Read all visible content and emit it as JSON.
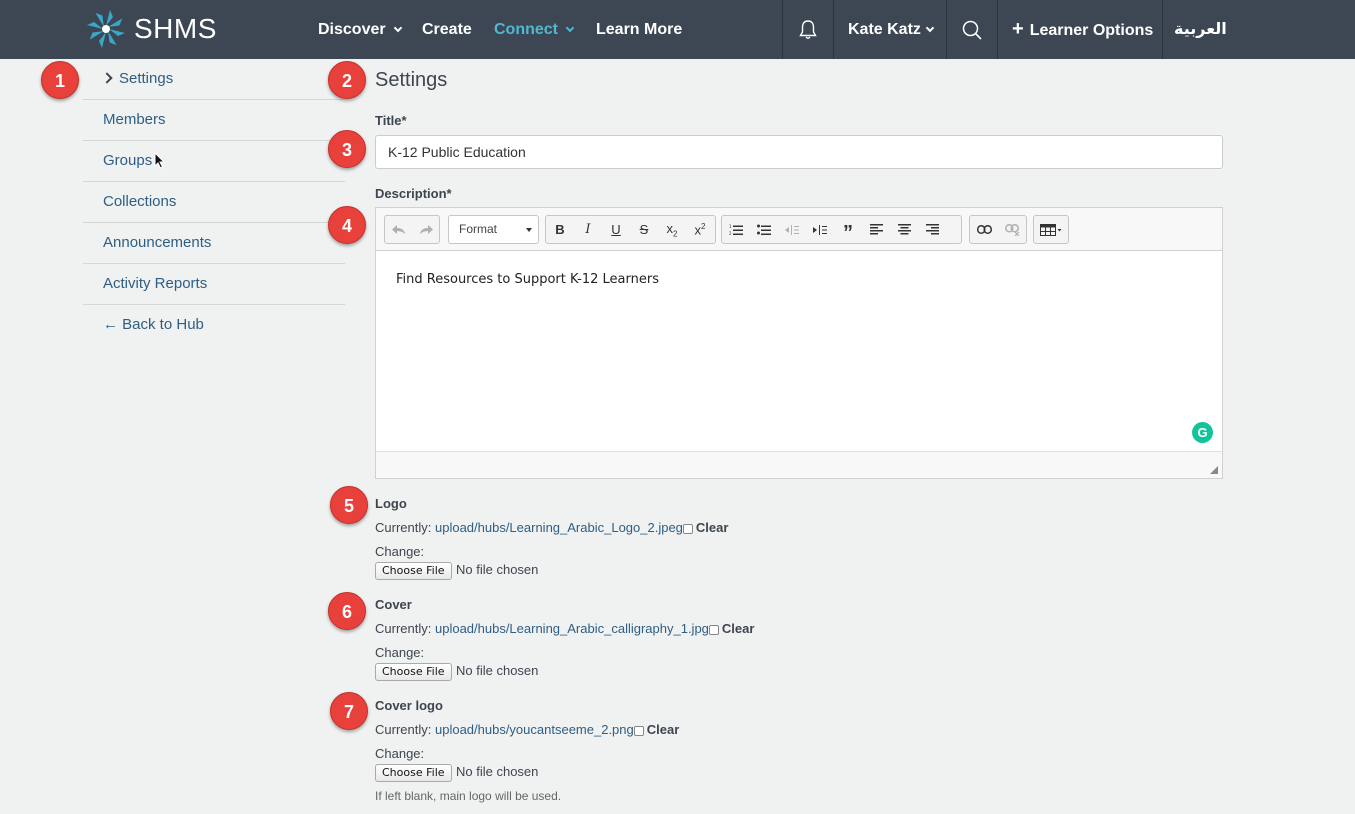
{
  "navbar": {
    "brand": "SHMS",
    "items": [
      {
        "label": "Discover"
      },
      {
        "label": "Create"
      },
      {
        "label": "Connect"
      },
      {
        "label": "Learn More"
      }
    ],
    "user_name": "Kate Katz",
    "learner_options": "Learner Options",
    "language": "العربية",
    "active_color": "#4fb9cf",
    "bg_color": "#3c4753"
  },
  "sidebar": {
    "items": [
      {
        "label": "Settings"
      },
      {
        "label": "Members"
      },
      {
        "label": "Groups"
      },
      {
        "label": "Collections"
      },
      {
        "label": "Announcements"
      },
      {
        "label": "Activity Reports"
      },
      {
        "label": "← Back to Hub"
      }
    ]
  },
  "badges": [
    "1",
    "2",
    "3",
    "4",
    "5",
    "6",
    "7"
  ],
  "main": {
    "title": "Settings",
    "title_field": {
      "label": "Title*",
      "value": "K-12 Public Education"
    },
    "description": {
      "label": "Description*",
      "format_label": "Format",
      "content": "Find Resources to Support K-12 Learners",
      "grammarly": "G"
    },
    "logo": {
      "label": "Logo",
      "currently": "Currently:",
      "path": "upload/hubs/Learning_Arabic_Logo_2.jpeg",
      "clear": "Clear",
      "change": "Change:",
      "choose": "Choose File",
      "nofile": "No file chosen"
    },
    "cover": {
      "label": "Cover",
      "currently": "Currently:",
      "path": "upload/hubs/Learning_Arabic_calligraphy_1.jpg",
      "clear": "Clear",
      "change": "Change:",
      "choose": "Choose File",
      "nofile": "No file chosen"
    },
    "cover_logo": {
      "label": "Cover logo",
      "currently": "Currently:",
      "path": "upload/hubs/youcantseeme_2.png",
      "clear": "Clear",
      "change": "Change:",
      "choose": "Choose File",
      "nofile": "No file chosen",
      "hint": "If left blank, main logo will be used."
    }
  }
}
